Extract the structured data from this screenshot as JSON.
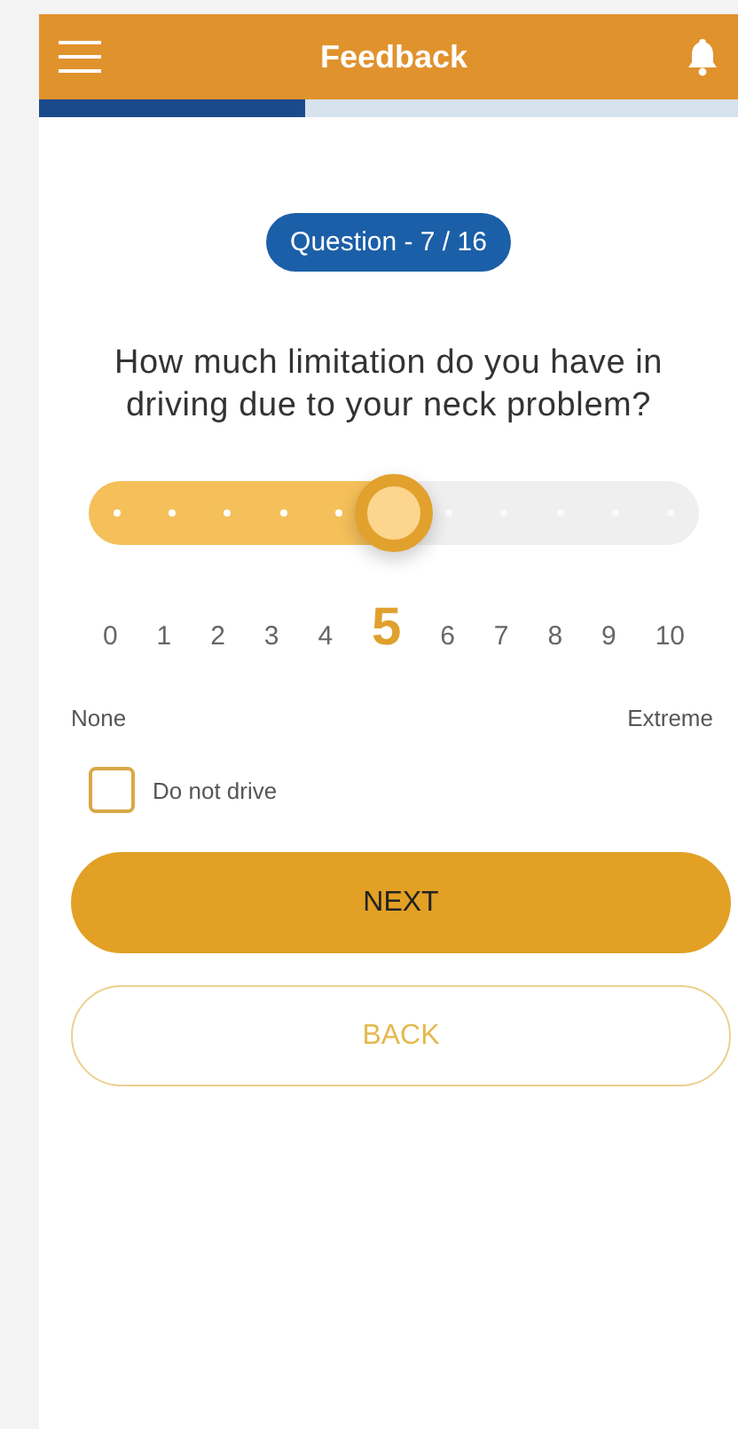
{
  "header": {
    "title": "Feedback"
  },
  "progress": {
    "level": 0.38
  },
  "question_badge": "Question - 7 / 16",
  "question": "How much limitation do you have in driving due to your neck problem?",
  "slider": {
    "level": 0.5
  },
  "scale": [
    {
      "label": "0",
      "selected": false
    },
    {
      "label": "1",
      "selected": false
    },
    {
      "label": "2",
      "selected": false
    },
    {
      "label": "3",
      "selected": false
    },
    {
      "label": "4",
      "selected": false
    },
    {
      "label": "5",
      "selected": true
    },
    {
      "label": "6",
      "selected": false
    },
    {
      "label": "7",
      "selected": false
    },
    {
      "label": "8",
      "selected": false
    },
    {
      "label": "9",
      "selected": false
    },
    {
      "label": "10",
      "selected": false
    }
  ],
  "scale_ends": {
    "min": "None",
    "max": "Extreme"
  },
  "option": {
    "label": "Do not drive",
    "checked": false
  },
  "buttons": [
    {
      "label": "NEXT",
      "kind": "primary"
    },
    {
      "label": "BACK",
      "kind": "secondary"
    }
  ]
}
